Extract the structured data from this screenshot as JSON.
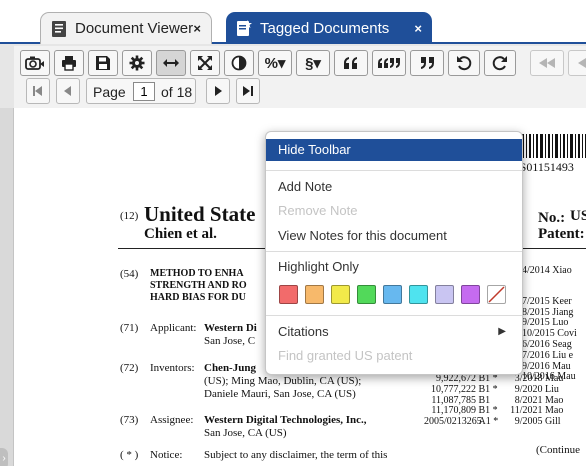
{
  "tabs": [
    {
      "label": "Document Viewer",
      "icon": "document-icon",
      "close": "×"
    },
    {
      "label": "Tagged Documents",
      "icon": "tag-document-icon",
      "close": "×"
    }
  ],
  "toolbar": {
    "buttons": [
      "camera-icon",
      "print-icon",
      "save-icon",
      "gear-icon",
      "fit-width-icon",
      "fit-page-icon",
      "contrast-icon",
      "zoom-percent-icon",
      "section-icon",
      "quote-open-icon",
      "quote-both-icon",
      "quote-close-icon",
      "undo-icon",
      "redo-icon",
      "skip-back-icon"
    ],
    "zoom_label": "%▾",
    "section_label": "§▾",
    "page_label": "Page",
    "page_value": "1",
    "page_of": "of 18"
  },
  "doc": {
    "barcode_number": "US01151493",
    "n12": "(12)",
    "country": "United State",
    "inventor_short": "Chien et al.",
    "no_label": "No.:",
    "no_value": "US",
    "patent_label": "Patent:",
    "n54": "(54)",
    "title_lines": [
      "METHOD TO ENHA",
      "STRENGTH AND RO",
      "HARD BIAS FOR DU"
    ],
    "n71": "(71)",
    "applicant_label": "Applicant:",
    "applicant": "Western Di",
    "applicant_city": "San Jose, C",
    "n72": "(72)",
    "inventors_label": "Inventors:",
    "inventors_lines": [
      "Chen-Jung",
      "(US); Ming Mao, Dublin, CA (US);",
      "Daniele Mauri, San Jose, CA (US)"
    ],
    "n73": "(73)",
    "assignee_label": "Assignee:",
    "assignee": "Western Digital Technologies, Inc.,",
    "assignee_city": "San Jose, CA (US)",
    "nstar": "( * )",
    "notice_label": "Notice:",
    "notice_text": "Subject to any disclaimer, the term of this",
    "refs_top": [
      {
        "date": "4/2014",
        "name": "Xiao"
      },
      {
        "date": "7/2015",
        "name": "Keer"
      },
      {
        "date": "8/2015",
        "name": "Jiang"
      },
      {
        "date": "9/2015",
        "name": "Luo"
      },
      {
        "date": "10/2015",
        "name": "Covi"
      },
      {
        "date": "6/2016",
        "name": "Seag"
      },
      {
        "date": "7/2016",
        "name": "Liu e"
      },
      {
        "date": "9/2016",
        "name": "Mau"
      },
      {
        "date": "10/2016",
        "name": "Mau"
      }
    ],
    "refs_bottom": [
      {
        "num": "9,922,672",
        "kind": "B1 *",
        "date": "3/2018",
        "name": "Mau"
      },
      {
        "num": "10,777,222",
        "kind": "B1 *",
        "date": "9/2020",
        "name": "Liu"
      },
      {
        "num": "11,087,785",
        "kind": "B1",
        "date": "8/2021",
        "name": "Mao"
      },
      {
        "num": "11,170,809",
        "kind": "B1 *",
        "date": "11/2021",
        "name": "Mao"
      },
      {
        "num": "2005/0213265",
        "kind": "A1 *",
        "date": "9/2005",
        "name": "Gill"
      }
    ],
    "continued": "(Continue"
  },
  "menu": {
    "hide_toolbar": "Hide Toolbar",
    "add_note": "Add Note",
    "remove_note": "Remove Note",
    "view_notes": "View Notes for this document",
    "highlight_only": "Highlight Only",
    "swatches": [
      "#f26b6b",
      "#f7b96b",
      "#f2ea4a",
      "#52d95a",
      "#67b8ef",
      "#4fe3ef",
      "#c9c5f2",
      "#c56bf0",
      "none"
    ],
    "citations": "Citations",
    "citations_arrow": "▶",
    "find_granted": "Find granted US patent"
  },
  "colors": {
    "accent": "#1f4f99"
  }
}
